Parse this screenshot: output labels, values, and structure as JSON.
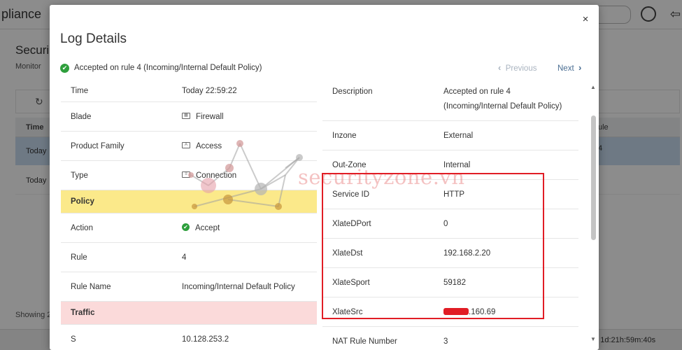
{
  "background": {
    "app_title": "pliance",
    "page_heading": "Securi",
    "page_sub": "Monitor",
    "time_header": "Time",
    "rule_header": "ule",
    "row1_time": "Today",
    "row2_time": "Today",
    "row1_rule": "4",
    "showing": "Showing 2",
    "uptime": "e: 1d:21h:59m:40s"
  },
  "modal": {
    "title": "Log Details",
    "close_label": "×",
    "summary": "Accepted on rule 4 (Incoming/Internal Default Policy)",
    "nav": {
      "previous": "Previous",
      "next": "Next"
    }
  },
  "left_panel": {
    "rows": [
      {
        "key": "Time",
        "value": "Today 22:59:22"
      },
      {
        "key": "Blade",
        "value": "Firewall",
        "icon": "firewall-icon"
      },
      {
        "key": "Product Family",
        "value": "Access",
        "icon": "access-icon"
      },
      {
        "key": "Type",
        "value": "Connection",
        "icon": "connection-icon"
      }
    ],
    "policy_section": "Policy",
    "policy_rows": [
      {
        "key": "Action",
        "value": "Accept",
        "icon": "accept-icon"
      },
      {
        "key": "Rule",
        "value": "4"
      },
      {
        "key": "Rule Name",
        "value": "Incoming/Internal Default Policy"
      }
    ],
    "traffic_section": "Traffic",
    "traffic_rows": [
      {
        "key": "S",
        "value": "10.128.253.2"
      }
    ]
  },
  "right_panel": {
    "rows": [
      {
        "key": "Description",
        "value_line1": "Accepted on rule 4",
        "value_line2": "(Incoming/Internal Default Policy)"
      },
      {
        "key": "Inzone",
        "value": "External"
      },
      {
        "key": "Out-Zone",
        "value": "Internal"
      },
      {
        "key": "Service ID",
        "value": "HTTP"
      },
      {
        "key": "XlateDPort",
        "value": "0"
      },
      {
        "key": "XlateDst",
        "value": "192.168.2.20"
      },
      {
        "key": "XlateSport",
        "value": "59182"
      },
      {
        "key": "XlateSrc",
        "value": ".160.69"
      },
      {
        "key": "NAT Rule Number",
        "value": "3"
      }
    ]
  },
  "watermark": "securityzone.vn",
  "colors": {
    "accept_green": "#2e9f3c",
    "policy_yellow": "#fbe98a",
    "traffic_pink": "#fbdada",
    "highlight_red": "#e11d25"
  }
}
